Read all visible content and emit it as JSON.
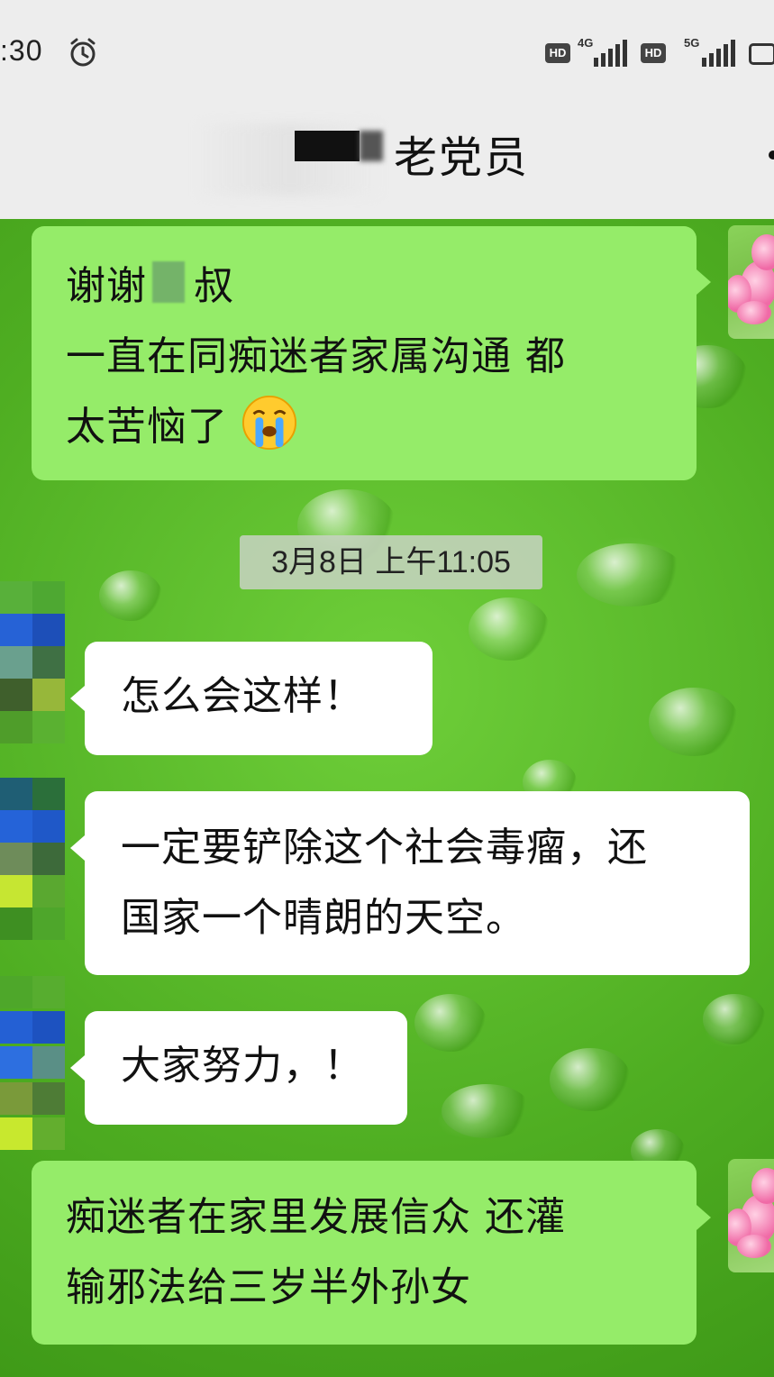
{
  "status_bar": {
    "time": ":30",
    "hd_label_1": "HD",
    "network_1": "4G",
    "hd_label_2": "HD",
    "network_2": "5G",
    "icons": [
      "alarm-icon",
      "signal-icon",
      "battery-icon"
    ]
  },
  "header": {
    "title": "老党员",
    "title_redacted": true
  },
  "messages": [
    {
      "direction": "outgoing",
      "lines": [
        "谢谢",
        "叔",
        "一直在同痴迷者家属沟通 都",
        "太苦恼了"
      ],
      "emoji": "crying-face"
    },
    {
      "type": "timestamp",
      "text": "3月8日 上午11:05"
    },
    {
      "direction": "incoming",
      "lines": [
        "怎么会这样！"
      ]
    },
    {
      "direction": "incoming",
      "lines": [
        "一定要铲除这个社会毒瘤，还",
        "国家一个晴朗的天空。"
      ]
    },
    {
      "direction": "incoming",
      "lines": [
        "大家努力，！"
      ]
    },
    {
      "direction": "outgoing",
      "lines": [
        "痴迷者在家里发展信众 还灌",
        "输邪法给三岁半外孙女"
      ]
    }
  ],
  "colors": {
    "outgoing_bubble": "#95ec69",
    "incoming_bubble": "#ffffff",
    "header_bg": "#ededed",
    "chat_bg": "#5fb92f"
  }
}
